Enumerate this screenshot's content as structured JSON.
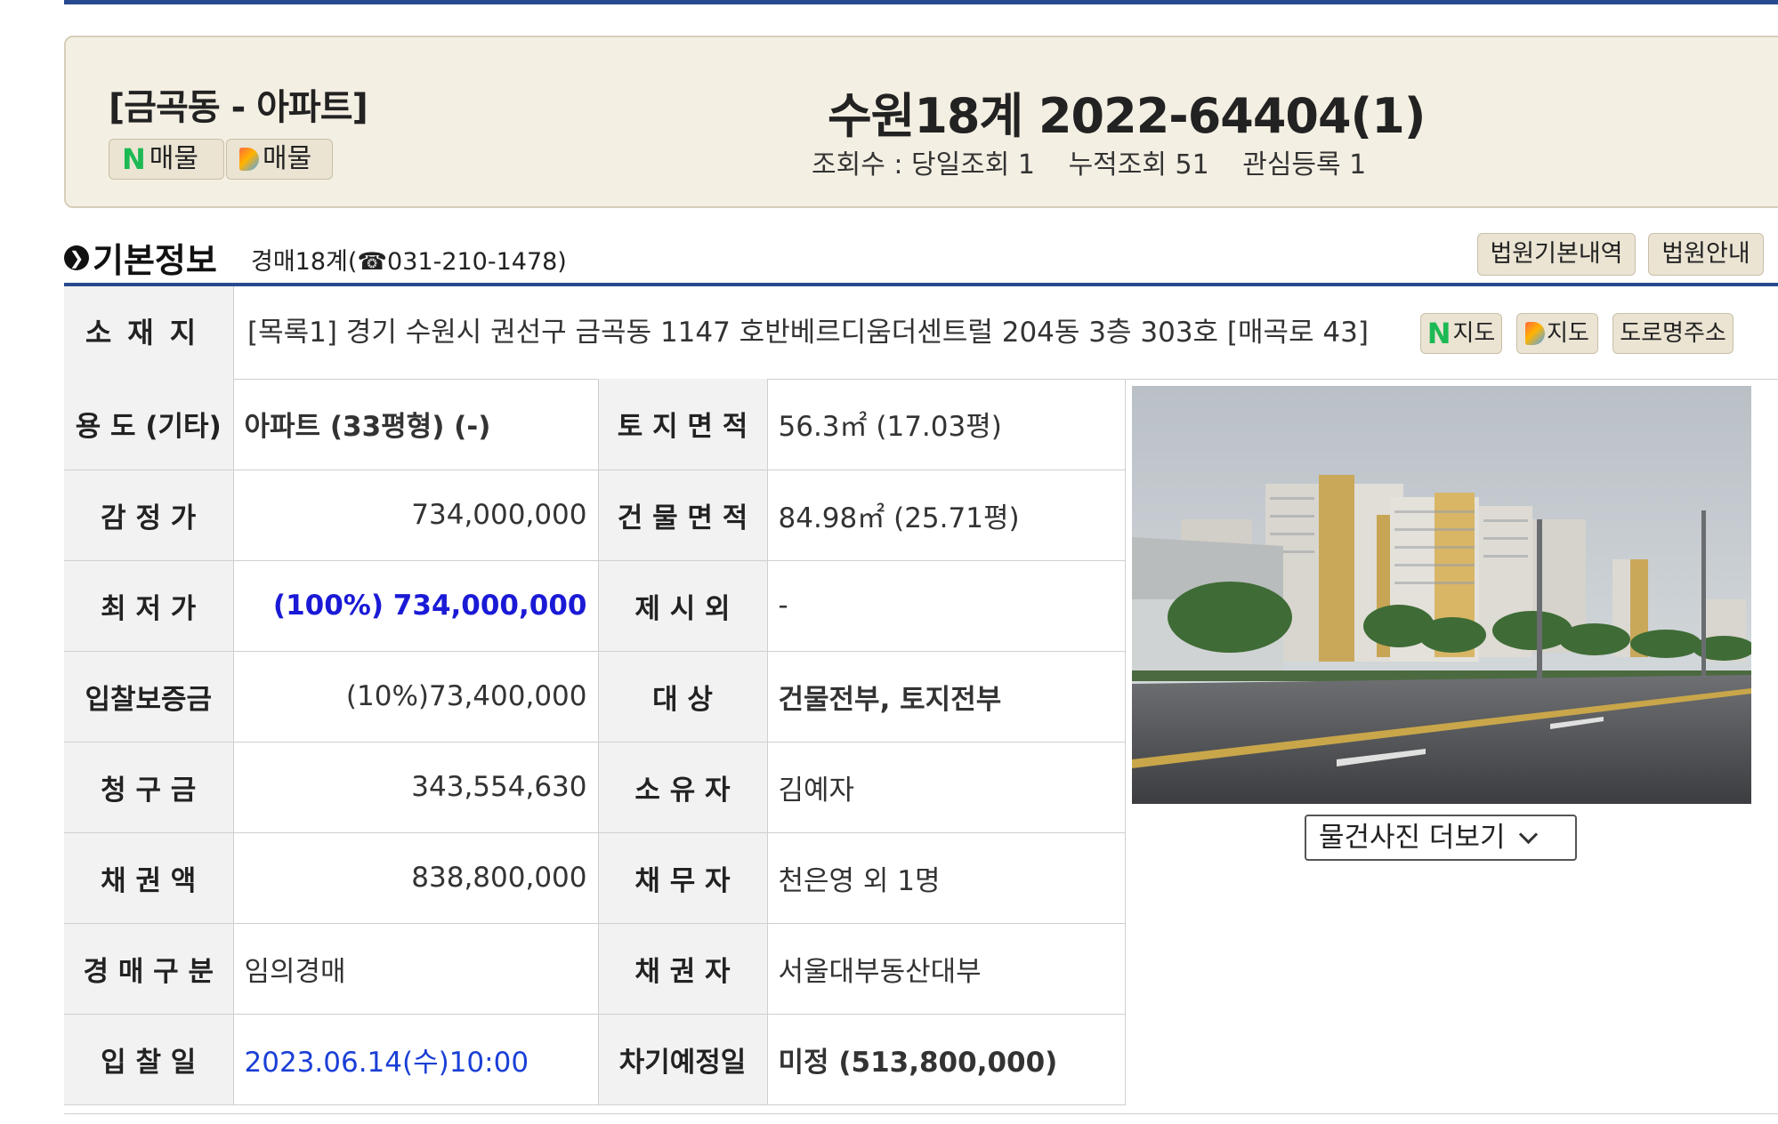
{
  "header": {
    "category": "[금곡동 - 아파트]",
    "case_title": "수원18계 2022-64404(1)",
    "n_listing_label": "매물",
    "d_listing_label": "매물",
    "views": {
      "today": "조회수 : 당일조회 1",
      "total": "누적조회 51",
      "interest": "관심등록 1"
    }
  },
  "section": {
    "title": "기본정보",
    "subtitle": "경매18계(☎031-210-1478)",
    "court_history_button": "법원기본내역",
    "court_guide_button": "법원안내"
  },
  "address": {
    "label": "소재지",
    "value": "[목록1] 경기 수원시 권선구 금곡동 1147 호반베르디움더센트럴 204동 3층 303호 [매곡로 43]",
    "n_map_label": "지도",
    "d_map_label": "지도",
    "road_address_button": "도로명주소"
  },
  "rows": [
    {
      "l1": "용 도 (기타)",
      "v1": "아파트 (33평형) (-)",
      "l2": "토 지 면 적",
      "v2": "56.3㎡ (17.03평)"
    },
    {
      "l1": "감 정 가",
      "v1": "734,000,000",
      "l2": "건 물 면 적",
      "v2": "84.98㎡ (25.71평)"
    },
    {
      "l1": "최 저 가",
      "v1": "(100%) 734,000,000",
      "l2": "제 시 외",
      "v2": "-"
    },
    {
      "l1": "입찰보증금",
      "v1": "(10%)73,400,000",
      "l2": "대 상",
      "v2": "건물전부, 토지전부"
    },
    {
      "l1": "청 구 금",
      "v1": "343,554,630",
      "l2": "소 유 자",
      "v2": "김예자"
    },
    {
      "l1": "채 권 액",
      "v1": "838,800,000",
      "l2": "채 무 자",
      "v2": "천은영 외 1명"
    },
    {
      "l1": "경 매 구 분",
      "v1": "임의경매",
      "l2": "채 권 자",
      "v2": "서울대부동산대부"
    },
    {
      "l1": "입 찰 일",
      "v1": "2023.06.14(수)10:00",
      "l2": "차기예정일",
      "v2": "미정 (513,800,000)"
    }
  ],
  "photo": {
    "more_button": "물건사진 더보기"
  },
  "colors": {
    "accent_line": "#274a8f",
    "header_bg": "#f4efe3",
    "blue_price": "#1a1ad6",
    "link_blue": "#1a3fd6",
    "naver_green": "#1db954"
  }
}
